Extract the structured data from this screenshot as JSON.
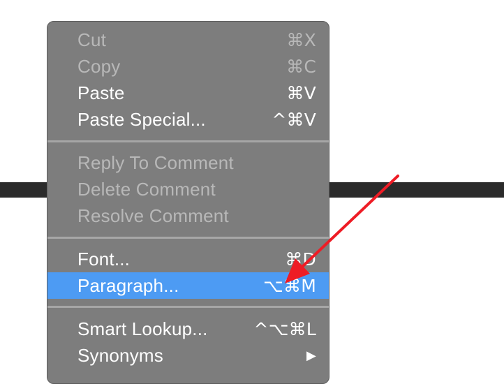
{
  "menu": {
    "group1": [
      {
        "label": "Cut",
        "shortcut": "⌘X"
      },
      {
        "label": "Copy",
        "shortcut": "⌘C"
      },
      {
        "label": "Paste",
        "shortcut": "⌘V"
      },
      {
        "label": "Paste Special...",
        "shortcut": "^⌘V"
      }
    ],
    "group2": [
      {
        "label": "Reply To Comment"
      },
      {
        "label": "Delete Comment"
      },
      {
        "label": "Resolve Comment"
      }
    ],
    "group3": [
      {
        "label": "Font...",
        "shortcut": "⌘D"
      },
      {
        "label": "Paragraph...",
        "shortcut": "⌥⌘M"
      }
    ],
    "group4": [
      {
        "label": "Smart Lookup...",
        "shortcut": "^⌥⌘L"
      },
      {
        "label": "Synonyms",
        "shortcut": "▶"
      }
    ]
  },
  "colors": {
    "menu_background": "#7d7d7d",
    "highlight": "#4d9bf3",
    "arrow": "#ee1c25"
  }
}
